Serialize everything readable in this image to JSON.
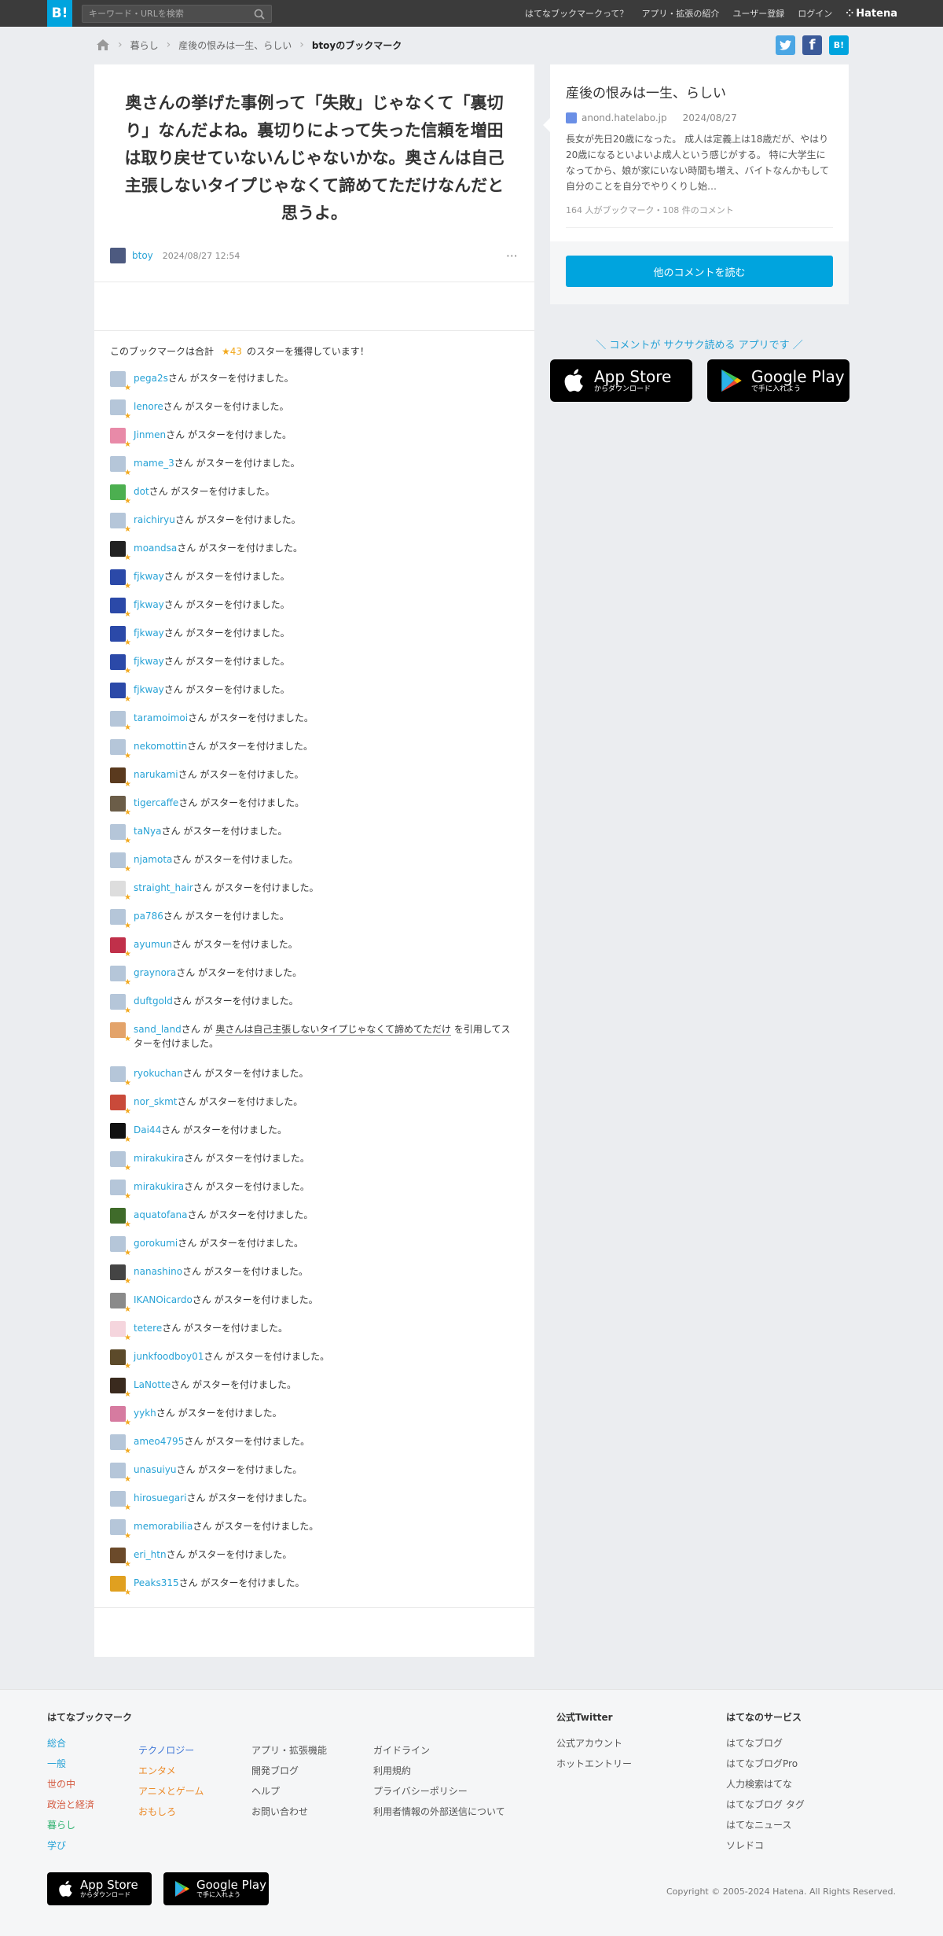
{
  "header": {
    "logo": "B!",
    "search_placeholder": "キーワード・URLを検索",
    "nav": [
      "はてなブックマークって？",
      "アプリ・拡張の紹介",
      "ユーザー登録",
      "ログイン"
    ],
    "brand": "Hatena"
  },
  "breadcrumb": {
    "items": [
      "暮らし",
      "産後の恨みは一生、らしい"
    ],
    "current": "btoyのブックマーク"
  },
  "share": {
    "facebook": "f",
    "hatena": "B!"
  },
  "bookmark": {
    "quote": "奥さんの挙げた事例って「失敗」じゃなくて「裏切り」なんだよね。裏切りによって失った信頼を増田は取り戻せていないんじゃないかな。奥さんは自己主張しないタイプじゃなくて諦めてただけなんだと思うよ。",
    "user": "btoy",
    "date": "2024/08/27 12:54",
    "more": "⋯"
  },
  "star_summary": {
    "prefix": "このブックマークは合計",
    "count": "★43",
    "suffix": "のスターを獲得しています！"
  },
  "star_suffix": "さん がスターを付けました。",
  "stars": [
    {
      "user": "pega2s",
      "color": "#b5c6d9"
    },
    {
      "user": "lenore",
      "color": "#b5c6d9"
    },
    {
      "user": "Jinmen",
      "color": "#e88aa8"
    },
    {
      "user": "mame_3",
      "color": "#b5c6d9"
    },
    {
      "user": "dot",
      "color": "#4caf50"
    },
    {
      "user": "raichiryu",
      "color": "#b5c6d9"
    },
    {
      "user": "moandsa",
      "color": "#222222"
    },
    {
      "user": "fjkway",
      "color": "#2b49a8"
    },
    {
      "user": "fjkway",
      "color": "#2b49a8"
    },
    {
      "user": "fjkway",
      "color": "#2b49a8"
    },
    {
      "user": "fjkway",
      "color": "#2b49a8"
    },
    {
      "user": "fjkway",
      "color": "#2b49a8"
    },
    {
      "user": "taramoimoi",
      "color": "#b5c6d9"
    },
    {
      "user": "nekomottin",
      "color": "#b5c6d9"
    },
    {
      "user": "narukami",
      "color": "#5a3a1e"
    },
    {
      "user": "tigercaffe",
      "color": "#6b5d48"
    },
    {
      "user": "taNya",
      "color": "#b5c6d9"
    },
    {
      "user": "njamota",
      "color": "#b5c6d9"
    },
    {
      "user": "straight_hair",
      "color": "#dddddd"
    },
    {
      "user": "pa786",
      "color": "#b5c6d9"
    },
    {
      "user": "ayumun",
      "color": "#c0304a"
    },
    {
      "user": "graynora",
      "color": "#b5c6d9"
    },
    {
      "user": "duftgold",
      "color": "#b5c6d9"
    },
    {
      "user": "sand_land",
      "color": "#e3a36a",
      "quote": "奥さんは自己主張しないタイプじゃなくて諦めてただけ",
      "quote_suffix": "を引用してスターを付けました。"
    },
    {
      "user": "ryokuchan",
      "color": "#b5c6d9"
    },
    {
      "user": "nor_skmt",
      "color": "#c94a3a"
    },
    {
      "user": "Dai44",
      "color": "#111111"
    },
    {
      "user": "mirakukira",
      "color": "#b5c6d9"
    },
    {
      "user": "mirakukira",
      "color": "#b5c6d9"
    },
    {
      "user": "aquatofana",
      "color": "#3f6b2a"
    },
    {
      "user": "gorokumi",
      "color": "#b5c6d9"
    },
    {
      "user": "nanashino",
      "color": "#444444"
    },
    {
      "user": "IKANOicardo",
      "color": "#8a8a8a"
    },
    {
      "user": "tetere",
      "color": "#f5d5dd"
    },
    {
      "user": "junkfoodboy01",
      "color": "#5c4a2a"
    },
    {
      "user": "LaNotte",
      "color": "#3a2a1e"
    },
    {
      "user": "yykh",
      "color": "#d67ba0"
    },
    {
      "user": "ameo4795",
      "color": "#b5c6d9"
    },
    {
      "user": "unasuiyu",
      "color": "#b5c6d9"
    },
    {
      "user": "hirosuegari",
      "color": "#b5c6d9"
    },
    {
      "user": "memorabilia",
      "color": "#b5c6d9"
    },
    {
      "user": "eri_htn",
      "color": "#6b4a2a"
    },
    {
      "user": "Peaks315",
      "color": "#e0a020"
    }
  ],
  "entry": {
    "title": "産後の恨みは一生、らしい",
    "domain": "anond.hatelabo.jp",
    "date": "2024/08/27",
    "description": "長女が先日20歳になった。 成人は定義上は18歳だが、やはり20歳になるといよいよ成人という感じがする。 特に大学生になってから、娘が家にいない時間も増え、バイトなんかもして自分のことを自分でやりくりし始…",
    "count": "164 人がブックマーク・108 件のコメント",
    "button": "他のコメントを読む"
  },
  "promo": {
    "text": "＼ コメントが サクサク読める アプリです ／",
    "app_store": {
      "big": "App Store",
      "small": "からダウンロード"
    },
    "google_play": {
      "big": "Google Play",
      "small": "で手に入れよう"
    }
  },
  "footer": {
    "col1_title": "はてなブックマーク",
    "cats_a": [
      {
        "label": "総合",
        "color": "blue"
      },
      {
        "label": "一般",
        "color": "blue"
      },
      {
        "label": "世の中",
        "color": "red"
      },
      {
        "label": "政治と経済",
        "color": "red"
      },
      {
        "label": "暮らし",
        "color": "green"
      },
      {
        "label": "学び",
        "color": "blue"
      }
    ],
    "cats_b": [
      {
        "label": "テクノロジー",
        "color": "purple"
      },
      {
        "label": "エンタメ",
        "color": "orange"
      },
      {
        "label": "アニメとゲーム",
        "color": "orange"
      },
      {
        "label": "おもしろ",
        "color": "orange"
      }
    ],
    "links_c": [
      "アプリ・拡張機能",
      "開発ブログ",
      "ヘルプ",
      "お問い合わせ"
    ],
    "links_d": [
      "ガイドライン",
      "利用規約",
      "プライバシーポリシー",
      "利用者情報の外部送信について"
    ],
    "twitter_title": "公式Twitter",
    "twitter_links": [
      "公式アカウント",
      "ホットエントリー"
    ],
    "services_title": "はてなのサービス",
    "services": [
      "はてなブログ",
      "はてなブログPro",
      "人力検索はてな",
      "はてなブログ タグ",
      "はてなニュース",
      "ソレドコ"
    ],
    "copyright": "Copyright © 2005-2024 Hatena. All Rights Reserved."
  }
}
